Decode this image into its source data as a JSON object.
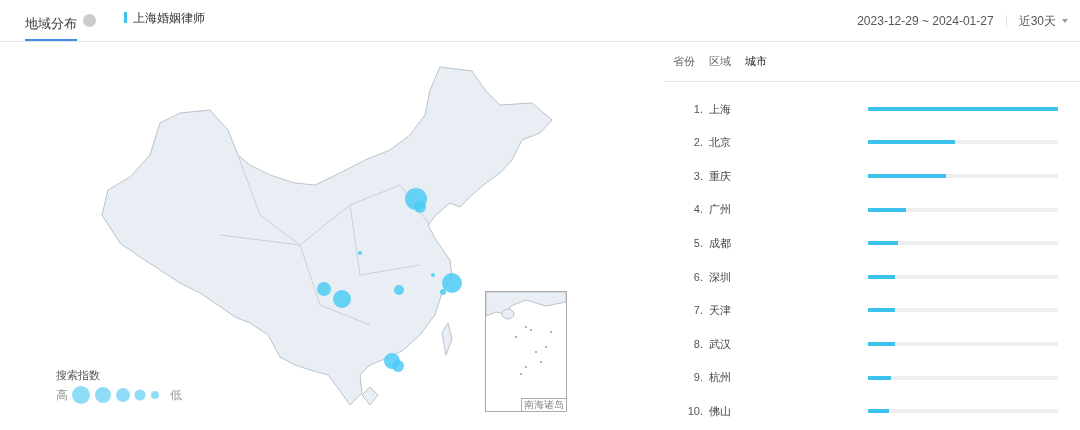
{
  "tabs": [
    {
      "label": "地域分布",
      "selected": true
    }
  ],
  "keyword": "上海婚姻律师",
  "date_range": "2023-12-29 ~ 2024-01-27",
  "period": "近30天",
  "map": {
    "inset_label": "南海诸岛",
    "legend": {
      "title": "搜索指数",
      "high": "高",
      "low": "低"
    }
  },
  "scope_tabs": [
    {
      "label": "省份",
      "selected": false
    },
    {
      "label": "区域",
      "selected": false
    },
    {
      "label": "城市",
      "selected": true
    }
  ],
  "ranking": [
    {
      "rank": "1.",
      "city": "上海",
      "level": 1.0
    },
    {
      "rank": "2.",
      "city": "北京",
      "level": 0.46
    },
    {
      "rank": "3.",
      "city": "重庆",
      "level": 0.41
    },
    {
      "rank": "4.",
      "city": "广州",
      "level": 0.2
    },
    {
      "rank": "5.",
      "city": "成都",
      "level": 0.16
    },
    {
      "rank": "6.",
      "city": "深圳",
      "level": 0.14
    },
    {
      "rank": "7.",
      "city": "天津",
      "level": 0.14
    },
    {
      "rank": "8.",
      "city": "武汉",
      "level": 0.14
    },
    {
      "rank": "9.",
      "city": "杭州",
      "level": 0.12
    },
    {
      "rank": "10.",
      "city": "佛山",
      "level": 0.11
    }
  ]
}
